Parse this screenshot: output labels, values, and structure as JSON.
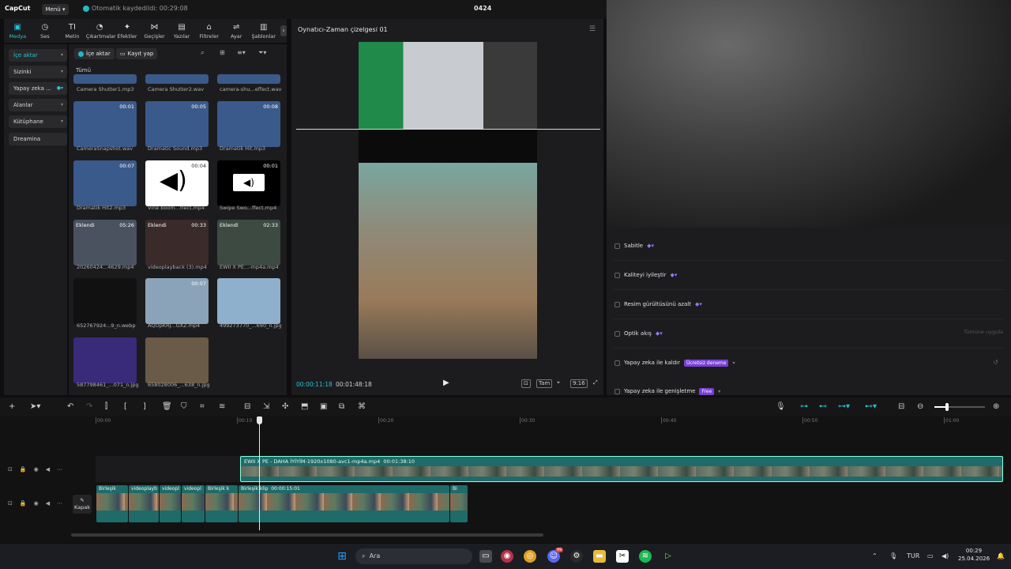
{
  "titlebar": {
    "logo": "CapCut",
    "menu_label": "Menü",
    "save_status": "Otomatik kaydedildi: 00:29:08",
    "project_title": "0424"
  },
  "toolbar": {
    "items": [
      {
        "label": "Medya",
        "icon": "media-icon",
        "active": true
      },
      {
        "label": "Ses",
        "icon": "audio-icon"
      },
      {
        "label": "Metin",
        "icon": "text-icon"
      },
      {
        "label": "Çıkartmalar",
        "icon": "sticker-icon"
      },
      {
        "label": "Efektler",
        "icon": "effects-icon"
      },
      {
        "label": "Geçişler",
        "icon": "transitions-icon"
      },
      {
        "label": "Yazılar",
        "icon": "captions-icon"
      },
      {
        "label": "Filtreler",
        "icon": "filters-icon"
      },
      {
        "label": "Ayar",
        "icon": "adjust-icon"
      },
      {
        "label": "Şablonlar",
        "icon": "templates-icon"
      }
    ]
  },
  "leftnav": {
    "items": [
      {
        "label": "İçe aktar",
        "active": true
      },
      {
        "label": "Sizinki"
      },
      {
        "label": "Yapay zeka ..."
      },
      {
        "label": "Alanlar"
      },
      {
        "label": "Kütüphane"
      },
      {
        "label": "Dreamina"
      }
    ]
  },
  "media": {
    "import_btn": "İçe aktar",
    "record_btn": "Kayıt yap",
    "all_label": "Tümü",
    "items": [
      {
        "label": "Camera Shutter1.mp3",
        "duration": "",
        "added": ""
      },
      {
        "label": "Camera Shutter2.wav",
        "duration": "",
        "added": ""
      },
      {
        "label": "camera-shu...effect.wav",
        "duration": "",
        "added": ""
      },
      {
        "label": "CameraSnapshot.wav",
        "duration": "00:01",
        "added": ""
      },
      {
        "label": "Dramatic Sound.mp3",
        "duration": "00:05",
        "added": ""
      },
      {
        "label": "Dramatik Hit.mp3",
        "duration": "00:08",
        "added": ""
      },
      {
        "label": "Dramatik Hit2.mp3",
        "duration": "00:07",
        "added": ""
      },
      {
        "label": "Vine boom...ffect.mp4",
        "duration": "00:04",
        "added": ""
      },
      {
        "label": "Swipe Swo...ffect.mp4",
        "duration": "00:01",
        "added": ""
      },
      {
        "label": "20260424...4629.mp4",
        "duration": "05:26",
        "added": "Eklendi"
      },
      {
        "label": "videoplayback (3).mp4",
        "duration": "00:33",
        "added": "Eklendi"
      },
      {
        "label": "EWII X PE...-mp4a.mp4",
        "duration": "02:33",
        "added": "Eklendi"
      },
      {
        "label": "652767924...9_n.webp",
        "duration": "",
        "added": ""
      },
      {
        "label": "AQOpKRJ...GXZ.mp4",
        "duration": "00:07",
        "added": ""
      },
      {
        "label": "499273770_...690_n.jpg",
        "duration": "",
        "added": ""
      },
      {
        "label": "587798461_...071_n.jpg",
        "duration": "",
        "added": ""
      },
      {
        "label": "658028006_...638_n.jpg",
        "duration": "",
        "added": ""
      }
    ]
  },
  "player": {
    "title": "Oynatıcı-Zaman çizelgesi 01",
    "current_time": "00:00:11:18",
    "total_time": "00:01:48:18",
    "full_label": "Tam",
    "ratio_label": "9:16"
  },
  "rightpanel": {
    "rows": [
      {
        "label": "Sabitle",
        "badge": "",
        "extra": ""
      },
      {
        "label": "Kaliteyi iyileştir",
        "badge": "",
        "extra": ""
      },
      {
        "label": "Resim gürültüsünü azalt",
        "badge": "",
        "extra": ""
      },
      {
        "label": "Optik akış",
        "badge": "",
        "extra": "Tümüne uygula"
      },
      {
        "label": "Yapay zeka ile kaldır",
        "badge": "Ücretsiz deneme",
        "extra": ""
      },
      {
        "label": "Yapay zeka ile genişletme",
        "badge": "Free",
        "extra": ""
      }
    ]
  },
  "timeline": {
    "ruler": [
      "00:00",
      "00:10",
      "00:20",
      "00:30",
      "00:40",
      "00:50",
      "01:00"
    ],
    "main_clip": {
      "name": "EWII X PE - DAHA İYİYİM-1920x1080-avc1-mp4a.mp4",
      "duration": "00:01:38:10"
    },
    "sub_clips": [
      {
        "name": "Birleşik"
      },
      {
        "name": "videoplayb"
      },
      {
        "name": "videopl"
      },
      {
        "name": "videopl"
      },
      {
        "name": "Birleşik k"
      },
      {
        "name": "Birleşik klip",
        "duration": "00:00:15:01"
      },
      {
        "name": "Bi"
      }
    ],
    "cover_label": "Kapak"
  },
  "taskbar": {
    "search_label": "Ara",
    "lang": "TUR",
    "time": "00:29",
    "date": "25.04.2026",
    "notif_count": "99"
  },
  "colors": {
    "accent": "#22c3d6",
    "clip": "#1f6b69",
    "audio_thumb": "#3b5a8c"
  }
}
